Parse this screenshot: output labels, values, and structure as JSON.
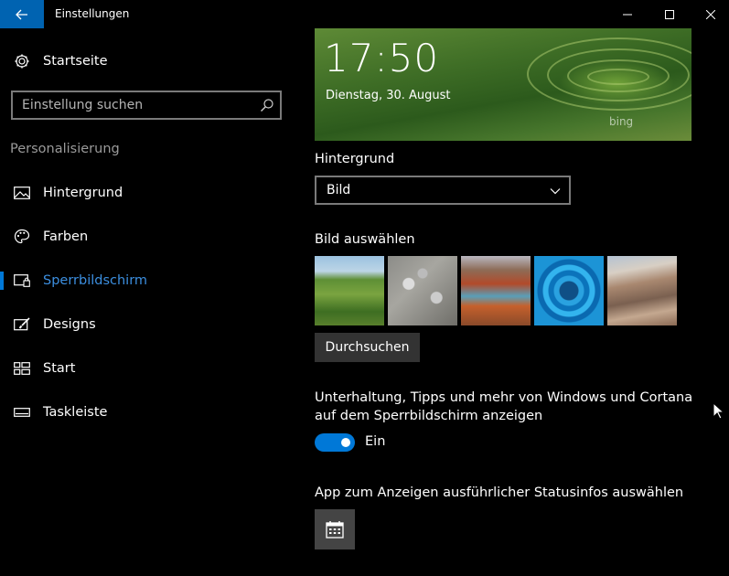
{
  "window": {
    "title": "Einstellungen"
  },
  "sidebar": {
    "home_label": "Startseite",
    "search_placeholder": "Einstellung suchen",
    "section_label": "Personalisierung",
    "items": [
      {
        "label": "Hintergrund",
        "icon": "image-icon",
        "active": false
      },
      {
        "label": "Farben",
        "icon": "palette-icon",
        "active": false
      },
      {
        "label": "Sperrbildschirm",
        "icon": "lock-screen-icon",
        "active": true
      },
      {
        "label": "Designs",
        "icon": "brush-icon",
        "active": false
      },
      {
        "label": "Start",
        "icon": "start-icon",
        "active": false
      },
      {
        "label": "Taskleiste",
        "icon": "taskbar-icon",
        "active": false
      }
    ]
  },
  "preview": {
    "time": "17:50",
    "date": "Dienstag, 30. August",
    "watermark": "bing"
  },
  "background": {
    "label": "Hintergrund",
    "selected": "Bild"
  },
  "picture": {
    "label": "Bild auswählen",
    "thumbnails": [
      "green-terraces",
      "zebras",
      "river-autumn",
      "blue-circle",
      "dunes"
    ],
    "browse_label": "Durchsuchen"
  },
  "tips": {
    "description": "Unterhaltung, Tipps und mehr von Windows und Cortana auf dem Sperrbildschirm anzeigen",
    "state_label": "Ein",
    "on": true
  },
  "status_app": {
    "label": "App zum Anzeigen ausführlicher Statusinfos auswählen",
    "icon": "calendar-icon"
  },
  "colors": {
    "accent": "#0078d7",
    "active_text": "#3c8fe0",
    "background": "#000000"
  }
}
